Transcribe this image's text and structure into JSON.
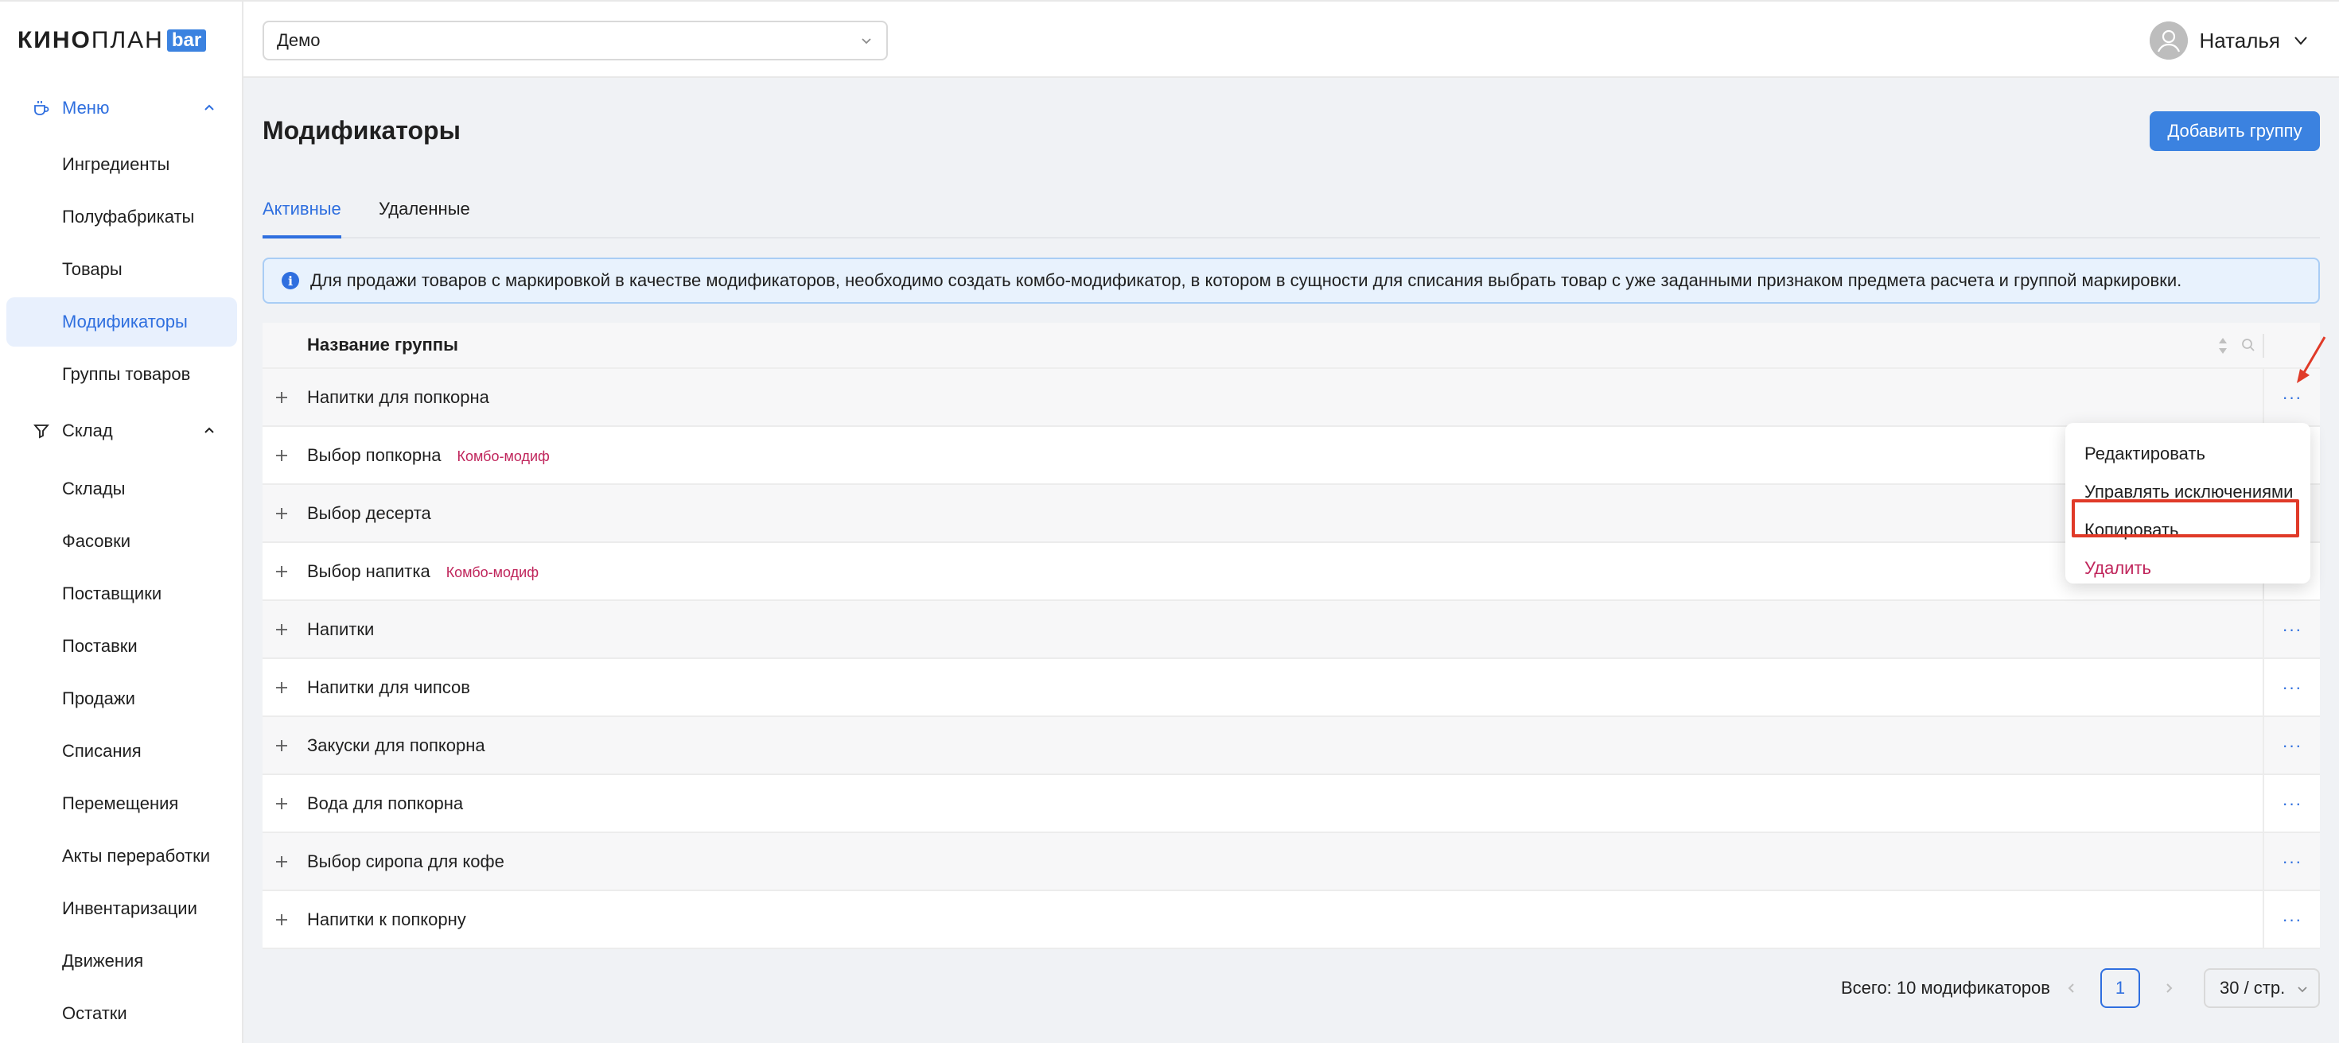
{
  "logo": {
    "bold": "КИНО",
    "light": "ПЛАН",
    "badge": "bar"
  },
  "sidebar": {
    "groups": [
      {
        "label": "Меню",
        "icon": "coffee-cup-icon",
        "expanded": true,
        "active": true
      },
      {
        "label": "Склад",
        "icon": "filter-icon",
        "expanded": true,
        "active": false
      }
    ],
    "menu_items": [
      "Ингредиенты",
      "Полуфабрикаты",
      "Товары",
      "Модификаторы",
      "Группы товаров"
    ],
    "menu_active": "Модификаторы",
    "warehouse_items": [
      "Склады",
      "Фасовки",
      "Поставщики",
      "Поставки",
      "Продажи",
      "Списания",
      "Перемещения",
      "Акты переработки",
      "Инвентаризации",
      "Движения",
      "Остатки"
    ]
  },
  "header": {
    "cinema_select": "Демо",
    "user_name": "Наталья"
  },
  "page": {
    "title": "Модификаторы",
    "add_button": "Добавить группу",
    "tabs": [
      {
        "label": "Активные",
        "active": true
      },
      {
        "label": "Удаленные",
        "active": false
      }
    ],
    "alert": "Для продажи товаров с маркировкой в качестве модификаторов, необходимо создать комбо-модификатор, в котором в сущности для списания выбрать товар с уже заданными признаком предмета расчета и группой маркировки."
  },
  "table": {
    "column_title": "Название группы",
    "rows": [
      {
        "name": "Напитки для попкорна",
        "tag": ""
      },
      {
        "name": "Выбор попкорна",
        "tag": "Комбо-модиф"
      },
      {
        "name": "Выбор десерта",
        "tag": ""
      },
      {
        "name": "Выбор напитка",
        "tag": "Комбо-модиф"
      },
      {
        "name": "Напитки",
        "tag": ""
      },
      {
        "name": "Напитки для чипсов",
        "tag": ""
      },
      {
        "name": "Закуски для попкорна",
        "tag": ""
      },
      {
        "name": "Вода для попкорна",
        "tag": ""
      },
      {
        "name": "Выбор сиропа для кофе",
        "tag": ""
      },
      {
        "name": "Напитки к попкорну",
        "tag": ""
      }
    ],
    "actions_glyph": "···"
  },
  "context_menu": {
    "items": [
      "Редактировать",
      "Управлять исключениями",
      "Копировать",
      "Удалить"
    ],
    "highlighted": "Копировать"
  },
  "pagination": {
    "total": "Всего: 10 модификаторов",
    "current_page": "1",
    "page_size": "30 / стр.",
    "prev": "‹",
    "next": "›"
  },
  "colors": {
    "accent": "#3b82e0",
    "active_text": "#2f6fdf",
    "tag": "#c0265c",
    "highlight_box": "#e03a28",
    "arrow": "#e03a28"
  }
}
